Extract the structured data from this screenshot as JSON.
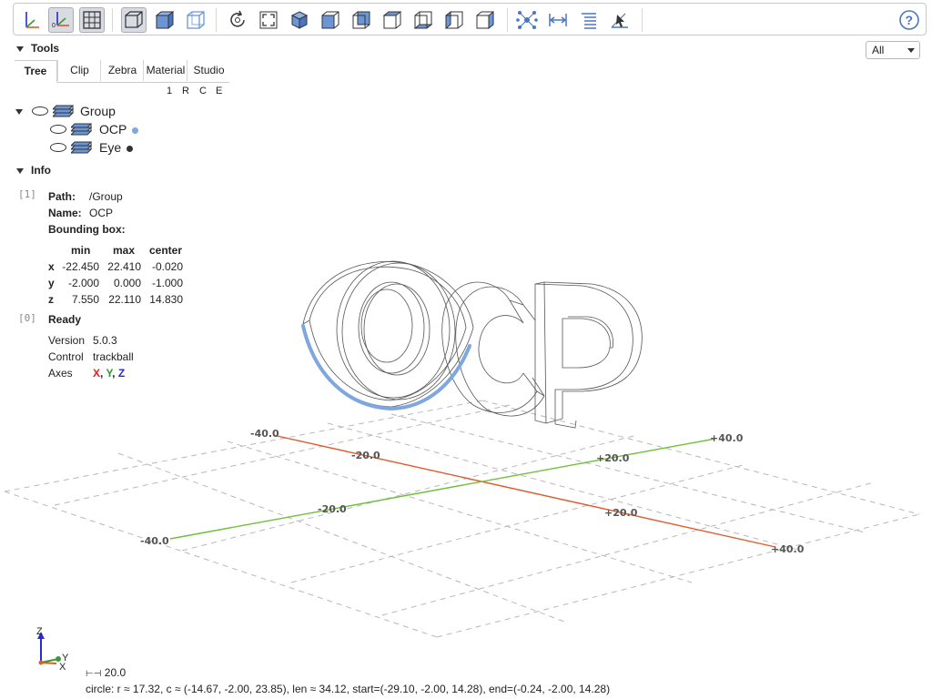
{
  "toolbar": {
    "icons": [
      "axes-icon",
      "axes-origin-icon",
      "grid-icon",
      "perspective-icon",
      "shaded-cube-icon",
      "wireframe-cube-icon",
      "reset-view-icon",
      "fit-view-icon",
      "iso-view-icon",
      "front-view-icon",
      "rear-view-icon",
      "top-view-icon",
      "bottom-view-icon",
      "left-view-icon",
      "right-view-icon",
      "explode-icon",
      "distance-measure-icon",
      "properties-icon",
      "select-icon",
      "help-icon"
    ]
  },
  "tools": {
    "title": "Tools",
    "tabs": [
      "Tree",
      "Clip",
      "Zebra",
      "Material",
      "Studio"
    ],
    "active_tab": "Tree",
    "flags": [
      "1",
      "R",
      "C",
      "E"
    ]
  },
  "tree": {
    "group": "Group",
    "children": [
      {
        "name": "OCP",
        "dot_color": "#7ea6e0"
      },
      {
        "name": "Eye",
        "dot_color": "#333333"
      }
    ]
  },
  "info": {
    "title": "Info",
    "entry1": {
      "index": "[1]",
      "path_label": "Path:",
      "path": "/Group",
      "name_label": "Name:",
      "name": "OCP",
      "bbox_label": "Bounding box:",
      "headers": [
        "min",
        "max",
        "center"
      ],
      "rows": [
        {
          "axis": "x",
          "min": "-22.450",
          "max": "22.410",
          "center": "-0.020"
        },
        {
          "axis": "y",
          "min": "-2.000",
          "max": "0.000",
          "center": "-1.000"
        },
        {
          "axis": "z",
          "min": "7.550",
          "max": "22.110",
          "center": "14.830"
        }
      ]
    },
    "entry0": {
      "index": "[0]",
      "status": "Ready",
      "version_label": "Version",
      "version": "5.0.3",
      "control_label": "Control",
      "control": "trackball",
      "axes_label": "Axes",
      "axes": {
        "x": "X",
        "y": "Y",
        "z": "Z",
        "sep": ", "
      },
      "axes_colors": {
        "x": "#e02020",
        "y": "#2a9a2a",
        "z": "#2a2ad0"
      }
    }
  },
  "dropdown": {
    "value": "All"
  },
  "viewport": {
    "grid_labels": {
      "x_neg40": "-40.0",
      "x_neg20": "-20.0",
      "x_pos20": "+20.0",
      "x_pos40": "+40.0",
      "y_neg40": "-40.0",
      "y_neg20": "-20.0",
      "y_pos20": "+20.0",
      "y_pos40": "+40.0"
    },
    "colors": {
      "x_axis": "#e05a2a",
      "y_axis": "#6fbf3a",
      "highlight": "#7ea6e0",
      "edges": "#555555"
    },
    "mini_axes": {
      "z": "Z",
      "y": "Y",
      "x": "X"
    }
  },
  "status": {
    "scale": "20.0",
    "measure": "circle: r ≈ 17.32, c ≈ (-14.67, -2.00, 23.85), len ≈ 34.12, start=(-29.10, -2.00, 14.28), end=(-0.24, -2.00, 14.28)"
  }
}
